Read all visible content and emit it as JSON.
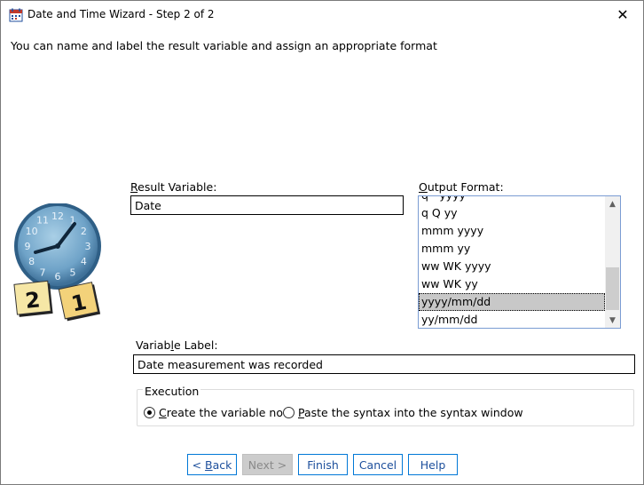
{
  "window": {
    "title": "Date and Time Wizard - Step 2 of 2",
    "close_symbol": "✕"
  },
  "intro_text": "You can name and label the result variable and assign an appropriate format",
  "result_variable": {
    "label_underlined": "R",
    "label_rest": "esult Variable:",
    "value": "Date"
  },
  "output_format": {
    "label_underlined": "O",
    "label_rest": "utput Format:",
    "items": [
      "q - yyyy",
      "q Q yy",
      "mmm yyyy",
      "mmm yy",
      "ww WK yyyy",
      "ww WK yy",
      "yyyy/mm/dd",
      "yy/mm/dd"
    ],
    "selected": "yyyy/mm/dd",
    "scroll_up": "▲",
    "scroll_down": "▼"
  },
  "variable_label": {
    "label_before": "Variab",
    "label_underlined": "l",
    "label_after": "e Label:",
    "value": "Date measurement was recorded"
  },
  "execution": {
    "legend": "Execution",
    "options": [
      {
        "underlined": "C",
        "rest": "reate the variable now",
        "selected": true
      },
      {
        "underlined": "P",
        "rest": "aste the syntax into the syntax window",
        "selected": false
      }
    ]
  },
  "buttons": {
    "back_prefix": "< ",
    "back_underlined": "B",
    "back_rest": "ack",
    "next": "Next >",
    "finish": "Finish",
    "cancel": "Cancel",
    "help": "Help"
  },
  "clock": {
    "numbers": [
      "12",
      "1",
      "2",
      "3",
      "4",
      "5",
      "6",
      "7",
      "8",
      "9",
      "10",
      "11"
    ],
    "calendar_left": "2",
    "calendar_right": "1"
  },
  "colors": {
    "accent": "#0078d7",
    "selection": "#c8c8c8",
    "disabled_button": "#cccccc"
  }
}
